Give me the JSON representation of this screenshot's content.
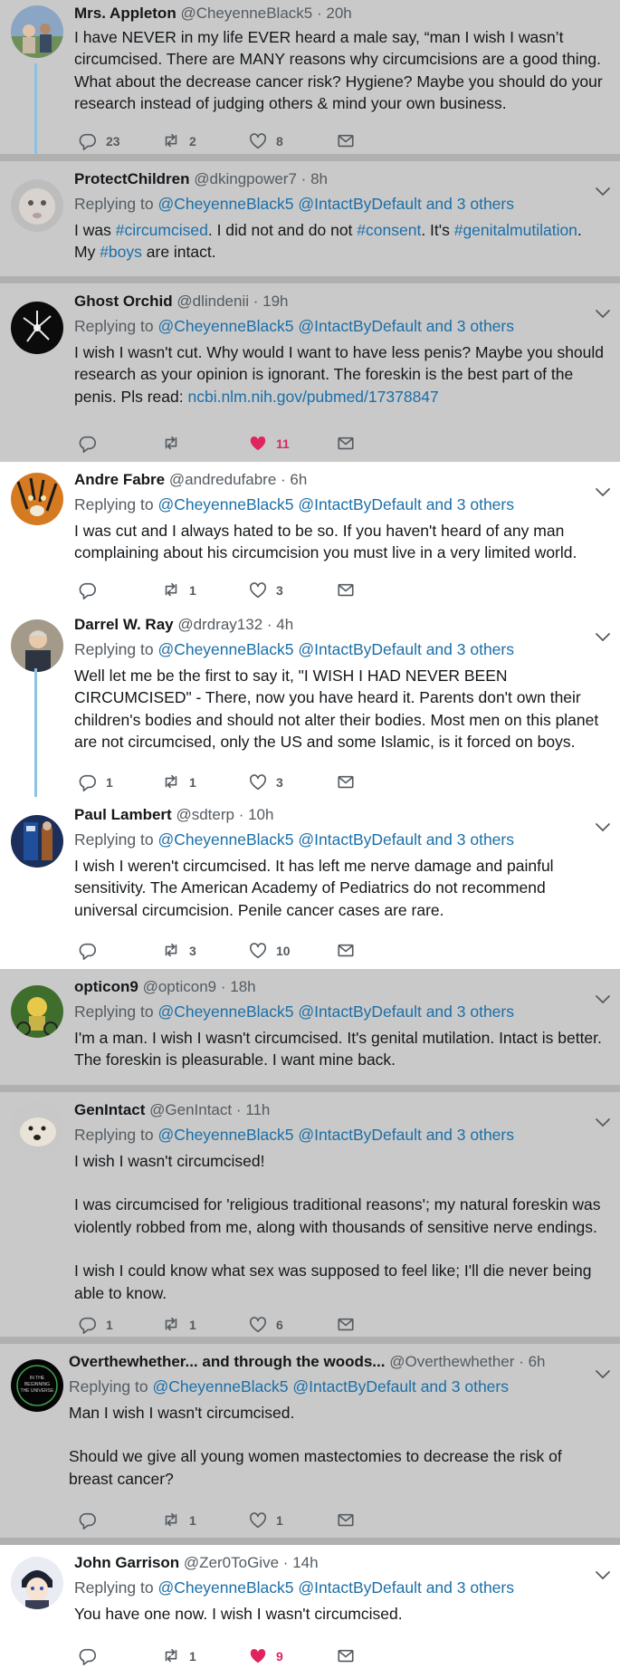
{
  "tweets": [
    {
      "name": "Mrs. Appleton",
      "handle": "@CheyenneBlack5",
      "sep": "·",
      "time": "20h",
      "paragraphs": [
        "I have NEVER in my life EVER heard a male say, “man I wish I wasn’t circumcised. There are MANY reasons why circumcisions are a good thing. What about the decrease cancer risk? Hygiene? Maybe you should do your research instead of judging others & mind your own business."
      ],
      "replies": "23",
      "retweets": "2",
      "likes": "8",
      "liked": false,
      "bg": "gray"
    },
    {
      "name": "ProtectChildren",
      "handle": "@dkingpower7",
      "sep": "·",
      "time": "8h",
      "replying_label": "Replying to",
      "reply_to": [
        "@CheyenneBlack5",
        "@IntactByDefault"
      ],
      "reply_others": "and 3 others",
      "segments": [
        {
          "t": "I was ",
          "link": false
        },
        {
          "t": "#circumcised",
          "link": true
        },
        {
          "t": ". I did not and do not ",
          "link": false
        },
        {
          "t": "#consent",
          "link": true
        },
        {
          "t": ". It's ",
          "link": false
        },
        {
          "t": "#genitalmutilation",
          "link": true
        },
        {
          "t": ". My ",
          "link": false
        },
        {
          "t": "#boys",
          "link": true
        },
        {
          "t": " are intact.",
          "link": false
        }
      ],
      "replies": "",
      "retweets": "",
      "likes": "",
      "liked": false,
      "bg": "gray"
    },
    {
      "name": "Ghost Orchid",
      "handle": "@dlindenii",
      "sep": "·",
      "time": "19h",
      "replying_label": "Replying to",
      "reply_to": [
        "@CheyenneBlack5",
        "@IntactByDefault"
      ],
      "reply_others": "and 3 others",
      "segments": [
        {
          "t": "I wish I wasn't cut. Why would I want to have less penis? Maybe you should research as your opinion is ignorant. The foreskin is the best part of the penis. Pls read: ",
          "link": false
        },
        {
          "t": "ncbi.nlm.nih.gov/pubmed/17378847",
          "link": true
        }
      ],
      "replies": "",
      "retweets": "",
      "likes": "11",
      "liked": true,
      "bg": "gray"
    },
    {
      "name": "Andre Fabre",
      "handle": "@andredufabre",
      "sep": "·",
      "time": "6h",
      "replying_label": "Replying to",
      "reply_to": [
        "@CheyenneBlack5",
        "@IntactByDefault"
      ],
      "reply_others": "and 3 others",
      "paragraphs": [
        "I was cut and I always hated to be so. If you haven't heard of any man complaining about his circumcision you must live in a very limited world."
      ],
      "replies": "",
      "retweets": "1",
      "likes": "3",
      "liked": false,
      "bg": "white"
    },
    {
      "name": "Darrel W. Ray",
      "handle": "@drdray132",
      "sep": "·",
      "time": "4h",
      "replying_label": "Replying to",
      "reply_to": [
        "@CheyenneBlack5",
        "@IntactByDefault"
      ],
      "reply_others": "and 3 others",
      "paragraphs": [
        "Well let me be the first to say it, \"I WISH I HAD NEVER BEEN CIRCUMCISED\" - There, now you have heard it. Parents don't own their children's bodies and should not alter their bodies. Most men on this planet are not circumcised, only the US and some Islamic, is it forced on boys."
      ],
      "replies": "1",
      "retweets": "1",
      "likes": "3",
      "liked": false,
      "bg": "white"
    },
    {
      "name": "Paul Lambert",
      "handle": "@sdterp",
      "sep": "·",
      "time": "10h",
      "replying_label": "Replying to",
      "reply_to": [
        "@CheyenneBlack5",
        "@IntactByDefault"
      ],
      "reply_others": "and 3 others",
      "paragraphs": [
        "I wish I weren't circumcised. It has left me nerve damage and painful sensitivity. The American Academy of Pediatrics do not recommend universal circumcision. Penile cancer cases are rare."
      ],
      "replies": "",
      "retweets": "3",
      "likes": "10",
      "liked": false,
      "bg": "white"
    },
    {
      "name": "opticon9",
      "handle": "@opticon9",
      "sep": "·",
      "time": "18h",
      "replying_label": "Replying to",
      "reply_to": [
        "@CheyenneBlack5",
        "@IntactByDefault"
      ],
      "reply_others": "and 3 others",
      "paragraphs": [
        "I'm a man. I wish I wasn't circumcised. It's genital mutilation. Intact is better. The foreskin is pleasurable. I want mine back."
      ],
      "replies": "",
      "retweets": "",
      "likes": "",
      "liked": false,
      "bg": "gray"
    },
    {
      "name": "GenIntact",
      "handle": "@GenIntact",
      "sep": "·",
      "time": "11h",
      "replying_label": "Replying to",
      "reply_to": [
        "@CheyenneBlack5",
        "@IntactByDefault"
      ],
      "reply_others": "and 3 others",
      "paragraphs": [
        "I wish I wasn't circumcised!",
        "I was circumcised for 'religious traditional reasons'; my natural foreskin was violently robbed from me, along with thousands of sensitive nerve endings.",
        "I wish I could know what sex was supposed to feel like; I'll die never being able to know."
      ],
      "replies": "1",
      "retweets": "1",
      "likes": "6",
      "liked": false,
      "bg": "gray"
    },
    {
      "name": "Overthewhether... and through the woods...",
      "handle": "@Overthewhether",
      "sep": "·",
      "time": "6h",
      "replying_label": "Replying to",
      "reply_to": [
        "@CheyenneBlack5",
        "@IntactByDefault"
      ],
      "reply_others": "and 3 others",
      "paragraphs": [
        "Man I wish I wasn't circumcised.",
        "Should we give all young women mastectomies to decrease the risk of breast cancer?"
      ],
      "replies": "",
      "retweets": "1",
      "likes": "1",
      "liked": false,
      "bg": "gray"
    },
    {
      "name": "John Garrison",
      "handle": "@Zer0ToGive",
      "sep": "·",
      "time": "14h",
      "replying_label": "Replying to",
      "reply_to": [
        "@CheyenneBlack5",
        "@IntactByDefault"
      ],
      "reply_others": "and 3 others",
      "paragraphs": [
        "You have one now.  I wish I wasn't circumcised."
      ],
      "replies": "",
      "retweets": "1",
      "likes": "9",
      "liked": true,
      "bg": "white"
    }
  ]
}
